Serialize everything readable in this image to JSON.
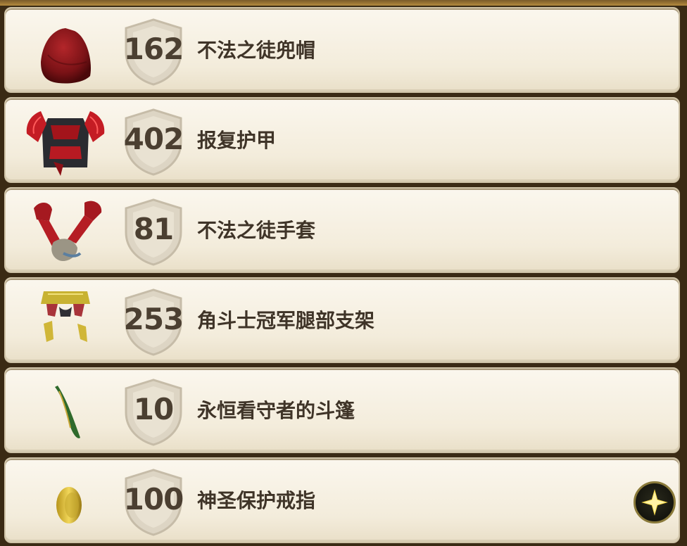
{
  "items": [
    {
      "score": "162",
      "name": "不法之徒兜帽",
      "icon": "red-hood-icon"
    },
    {
      "score": "402",
      "name": "报复护甲",
      "icon": "red-armor-icon"
    },
    {
      "score": "81",
      "name": "不法之徒手套",
      "icon": "red-gloves-icon"
    },
    {
      "score": "253",
      "name": "角斗士冠军腿部支架",
      "icon": "gold-leg-armor-icon"
    },
    {
      "score": "10",
      "name": "永恒看守者的斗篷",
      "icon": "green-cloak-icon"
    },
    {
      "score": "100",
      "name": "神圣保护戒指",
      "icon": "gold-ring-icon"
    }
  ],
  "action_button": {
    "icon": "star-icon"
  },
  "colors": {
    "panel": "#f3ecdb",
    "text": "#3f3428",
    "score": "#4b3f31",
    "shield": "#d8d0bf"
  }
}
